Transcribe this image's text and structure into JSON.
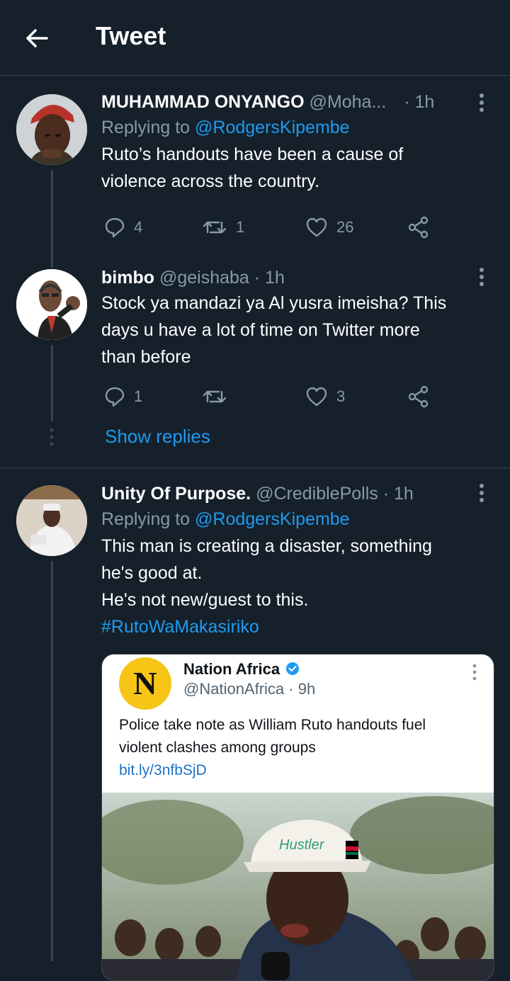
{
  "header": {
    "title": "Tweet"
  },
  "tweets": [
    {
      "name": "MUHAMMAD ONYANGO",
      "handle": "@Moha...",
      "time": "· 1h",
      "replying_prefix": "Replying to ",
      "replying_to": "@RodgersKipembe",
      "text_lines": [
        "Ruto’s handouts have been a cause of",
        "violence across the country."
      ],
      "replies": "4",
      "retweets": "1",
      "likes": "26"
    },
    {
      "name": "bimbo",
      "handle": "@geishaba",
      "time": "· 1h",
      "text_lines": [
        "Stock ya mandazi ya Al yusra imeisha? This",
        "days u have a lot of time on Twitter more",
        "than before"
      ],
      "replies": "1",
      "retweets": "",
      "likes": "3"
    },
    {
      "name": "Unity Of Purpose.",
      "handle": "@CrediblePolls",
      "time": "· 1h",
      "replying_prefix": "Replying to ",
      "replying_to": "@RodgersKipembe",
      "text_lines": [
        "This man is creating a disaster, something",
        "he's good at.",
        "He's not new/guest to this."
      ],
      "hashtag": "#RutoWaMakasiriko"
    }
  ],
  "show_replies": "Show replies",
  "quoted": {
    "logo_letter": "N",
    "name": "Nation Africa",
    "handle": "@NationAfrica · 9h",
    "text_lines": [
      "Police take note as William Ruto handouts fuel",
      "violent clashes among groups"
    ],
    "link": "bit.ly/3nfbSjD",
    "cap_text": "Hustler"
  },
  "colors": {
    "background": "#15202b",
    "accent": "#1d9bf0",
    "muted": "#8899a6",
    "verified": "#1d9bf0"
  }
}
